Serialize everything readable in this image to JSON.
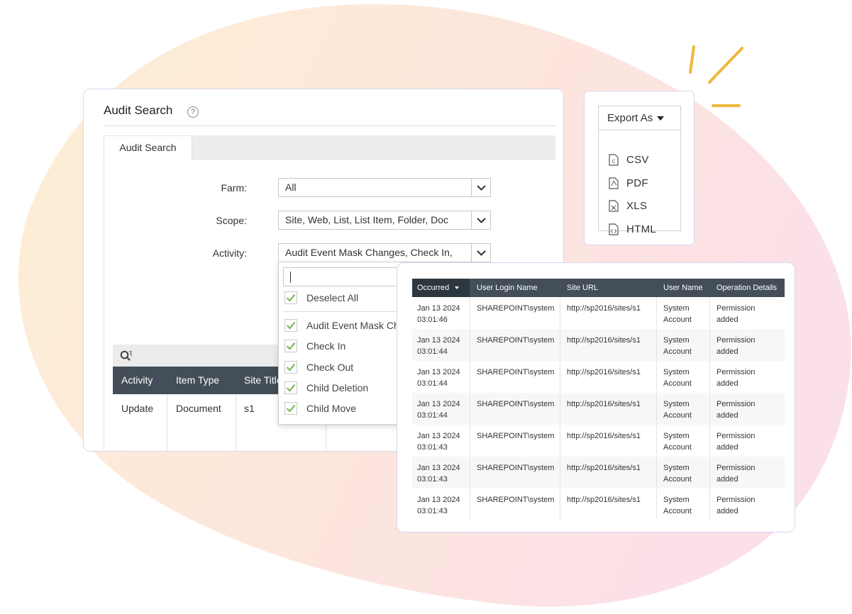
{
  "audit_search": {
    "title": "Audit Search",
    "help_icon": "question-circle-icon",
    "tab_label": "Audit Search",
    "fields": [
      {
        "label": "Farm:",
        "value": "All"
      },
      {
        "label": "Scope:",
        "value": "Site, Web, List, List Item, Folder, Doc"
      },
      {
        "label": "Activity:",
        "value": "Audit Event Mask Changes, Check In,"
      }
    ],
    "activity_dropdown": {
      "search_value": "",
      "deselect_all_label": "Deselect All",
      "options": [
        "Audit Event Mask Changes",
        "Check In",
        "Check Out",
        "Child Deletion",
        "Child Move"
      ]
    },
    "grid": {
      "search_icon": "search-filter-icon",
      "columns": [
        "Activity",
        "Item Type",
        "Site Title"
      ],
      "rows": [
        [
          "Update",
          "Document",
          "s1"
        ]
      ]
    }
  },
  "export": {
    "button_label": "Export As",
    "formats": [
      {
        "label": "CSV",
        "icon": "csv-file-icon"
      },
      {
        "label": "PDF",
        "icon": "pdf-file-icon"
      },
      {
        "label": "XLS",
        "icon": "xls-file-icon"
      },
      {
        "label": "HTML",
        "icon": "html-file-icon"
      }
    ]
  },
  "results_table": {
    "columns": [
      "Occurred",
      "User Login Name",
      "Site URL",
      "User Name",
      "Operation Details"
    ],
    "sorted_column": "Occurred",
    "rows": [
      {
        "date": "Jan 13 2024",
        "time": "03:01:46",
        "login": "SHAREPOINT\\system",
        "url": "http://sp2016/sites/s1",
        "user_line1": "System",
        "user_line2": "Account",
        "op_line1": "Permission",
        "op_line2": "added"
      },
      {
        "date": "Jan 13 2024",
        "time": "03:01:44",
        "login": "SHAREPOINT\\system",
        "url": "http://sp2016/sites/s1",
        "user_line1": "System",
        "user_line2": "Account",
        "op_line1": "Permission",
        "op_line2": "added"
      },
      {
        "date": "Jan 13 2024",
        "time": "03:01:44",
        "login": "SHAREPOINT\\system",
        "url": "http://sp2016/sites/s1",
        "user_line1": "System",
        "user_line2": "Account",
        "op_line1": "Permission",
        "op_line2": "added"
      },
      {
        "date": "Jan 13 2024",
        "time": "03:01:44",
        "login": "SHAREPOINT\\system",
        "url": "http://sp2016/sites/s1",
        "user_line1": "System",
        "user_line2": "Account",
        "op_line1": "Permission",
        "op_line2": "added"
      },
      {
        "date": "Jan 13 2024",
        "time": "03:01:43",
        "login": "SHAREPOINT\\system",
        "url": "http://sp2016/sites/s1",
        "user_line1": "System",
        "user_line2": "Account",
        "op_line1": "Permission",
        "op_line2": "added"
      },
      {
        "date": "Jan 13 2024",
        "time": "03:01:43",
        "login": "SHAREPOINT\\system",
        "url": "http://sp2016/sites/s1",
        "user_line1": "System",
        "user_line2": "Account",
        "op_line1": "Permission",
        "op_line2": "added"
      },
      {
        "date": "Jan 13 2024",
        "time": "03:01:43",
        "login": "SHAREPOINT\\system",
        "url": "http://sp2016/sites/s1",
        "user_line1": "System",
        "user_line2": "Account",
        "op_line1": "Permission",
        "op_line2": "added"
      }
    ]
  },
  "colors": {
    "table_header": "#434e58",
    "table_header_sorted": "#2d373f",
    "checkbox_check": "#7dbb5c",
    "accent_sparkle": "#efb83c",
    "card_border": "#d9d6f0"
  }
}
